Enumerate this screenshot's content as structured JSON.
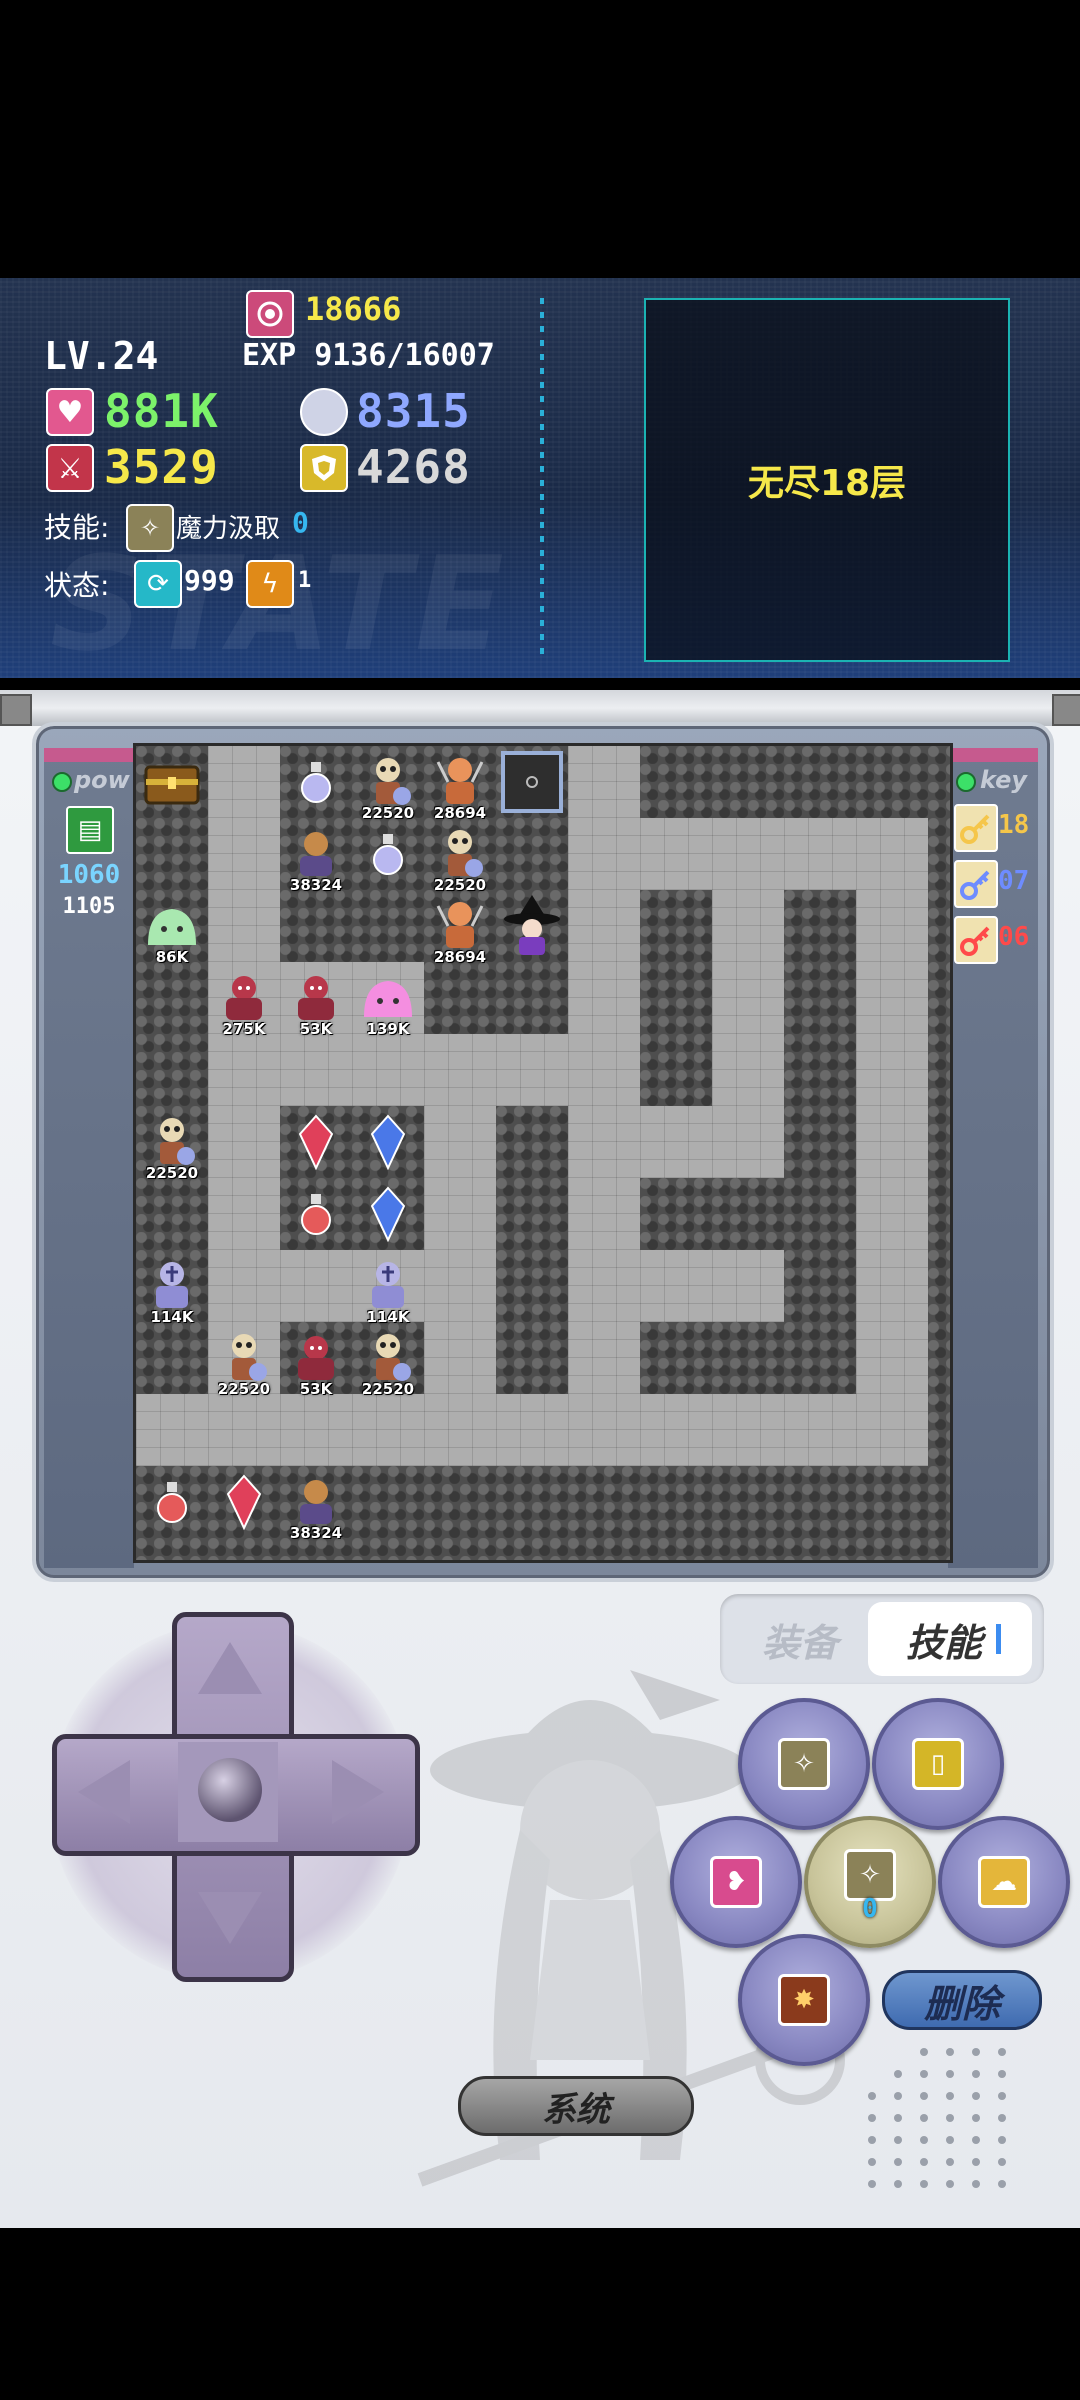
{
  "status": {
    "gold": "18666",
    "level": "LV.24",
    "exp": "EXP 9136/16007",
    "hp": "881K",
    "mp": "8315",
    "attack": "3529",
    "defense": "4268",
    "skill_label": "技能:",
    "skill_name": "魔力汲取",
    "skill_value": "0",
    "state_label": "状态:",
    "state_regen": "999",
    "state_bolt": "1",
    "watermark": "STATE"
  },
  "floor": {
    "name": "无尽18层"
  },
  "left_panel": {
    "title": "pow",
    "value_main": "1060",
    "value_sub": "1105"
  },
  "right_panel": {
    "title": "key",
    "keys": [
      {
        "count": "18",
        "color": "#f5c64a"
      },
      {
        "count": "07",
        "color": "#6e8cff"
      },
      {
        "count": "06",
        "color": "#ff4a4a"
      }
    ]
  },
  "monsters": [
    {
      "label": "22520"
    },
    {
      "label": "28694"
    },
    {
      "label": "38324"
    },
    {
      "label": "22520"
    },
    {
      "label": "28694"
    },
    {
      "label": "86K"
    },
    {
      "label": "275K"
    },
    {
      "label": "53K"
    },
    {
      "label": "139K"
    },
    {
      "label": "22520"
    },
    {
      "label": "114K"
    },
    {
      "label": "114K"
    },
    {
      "label": "22520"
    },
    {
      "label": "53K"
    },
    {
      "label": "22520"
    },
    {
      "label": "38324"
    }
  ],
  "tabs": {
    "equip": "装备",
    "skill": "技能"
  },
  "skill_slot_value": "0",
  "buttons": {
    "delete": "删除",
    "system": "系统"
  },
  "colors": {
    "hp": "#7cf26a",
    "mp": "#8fa8ff",
    "gold": "#f6e84a",
    "stat": "#f6e84a",
    "def": "#d9d9d9"
  }
}
